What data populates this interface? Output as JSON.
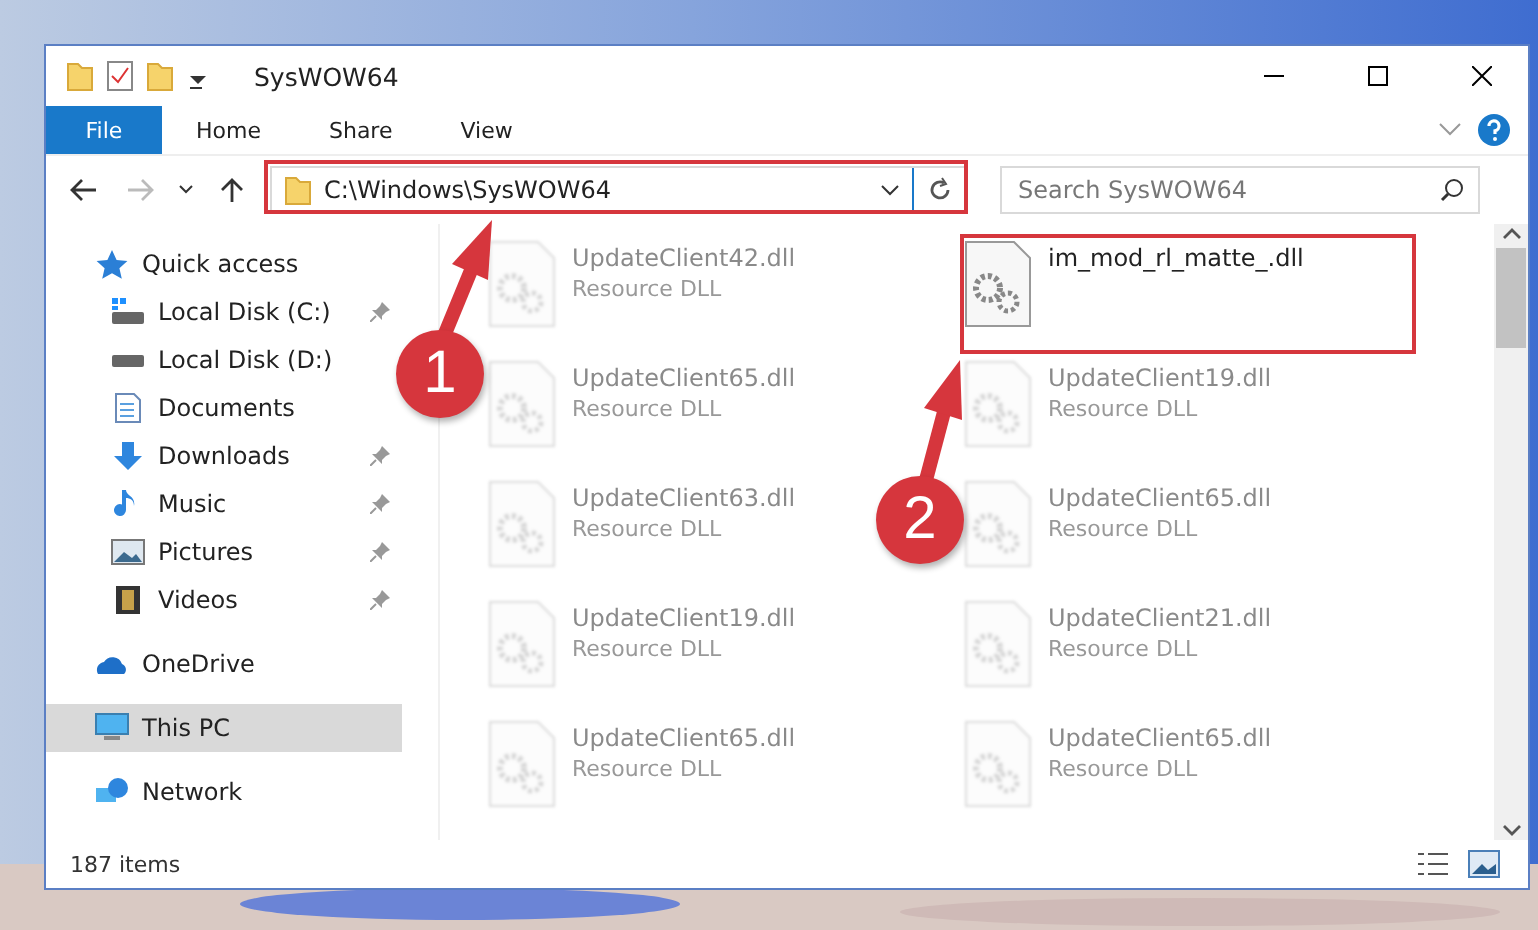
{
  "window": {
    "title": "SysWOW64"
  },
  "ribbon_tabs": [
    {
      "label": "File",
      "selected": true
    },
    {
      "label": "Home",
      "selected": false
    },
    {
      "label": "Share",
      "selected": false
    },
    {
      "label": "View",
      "selected": false
    }
  ],
  "address": {
    "path": "C:\\Windows\\SysWOW64",
    "highlighted": true
  },
  "search": {
    "placeholder": "Search SysWOW64"
  },
  "nav": [
    {
      "label": "Quick access",
      "kind": "star",
      "selected": false,
      "children": [
        {
          "label": "Local Disk (C:)",
          "kind": "system-drive",
          "pinned": true,
          "selected": false
        },
        {
          "label": "Local Disk (D:)",
          "kind": "drive",
          "pinned": false,
          "selected": false
        },
        {
          "label": "Documents",
          "kind": "documents",
          "pinned": false,
          "selected": false
        },
        {
          "label": "Downloads",
          "kind": "downloads",
          "pinned": true,
          "selected": false
        },
        {
          "label": "Music",
          "kind": "music",
          "pinned": true,
          "selected": false
        },
        {
          "label": "Pictures",
          "kind": "pictures",
          "pinned": true,
          "selected": false
        },
        {
          "label": "Videos",
          "kind": "videos",
          "pinned": true,
          "selected": false
        }
      ]
    },
    {
      "label": "OneDrive",
      "kind": "cloud",
      "selected": false
    },
    {
      "label": "This PC",
      "kind": "computer",
      "selected": true
    },
    {
      "label": "Network",
      "kind": "network",
      "selected": false
    }
  ],
  "files": [
    {
      "name": "UpdateClient42.dll",
      "type": "Resource DLL",
      "blurred": true,
      "highlighted": false
    },
    {
      "name": "im_mod_rl_matte_.dll",
      "blurred": false,
      "highlighted": true
    },
    {
      "name": "UpdateClient65.dll",
      "type": "Resource DLL",
      "blurred": true,
      "highlighted": false
    },
    {
      "name": "UpdateClient19.dll",
      "type": "Resource DLL",
      "blurred": true,
      "highlighted": false
    },
    {
      "name": "UpdateClient63.dll",
      "type": "Resource DLL",
      "blurred": true,
      "highlighted": false
    },
    {
      "name": "UpdateClient65.dll",
      "type": "Resource DLL",
      "blurred": true,
      "highlighted": false
    },
    {
      "name": "UpdateClient19.dll",
      "type": "Resource DLL",
      "blurred": true,
      "highlighted": false
    },
    {
      "name": "UpdateClient21.dll",
      "type": "Resource DLL",
      "blurred": true,
      "highlighted": false
    },
    {
      "name": "UpdateClient65.dll",
      "type": "Resource DLL",
      "blurred": true,
      "highlighted": false
    },
    {
      "name": "UpdateClient65.dll",
      "type": "Resource DLL",
      "blurred": true,
      "highlighted": false
    }
  ],
  "status_bar": {
    "count": "187 items"
  },
  "callouts": [
    {
      "number": "1"
    },
    {
      "number": "2"
    }
  ]
}
